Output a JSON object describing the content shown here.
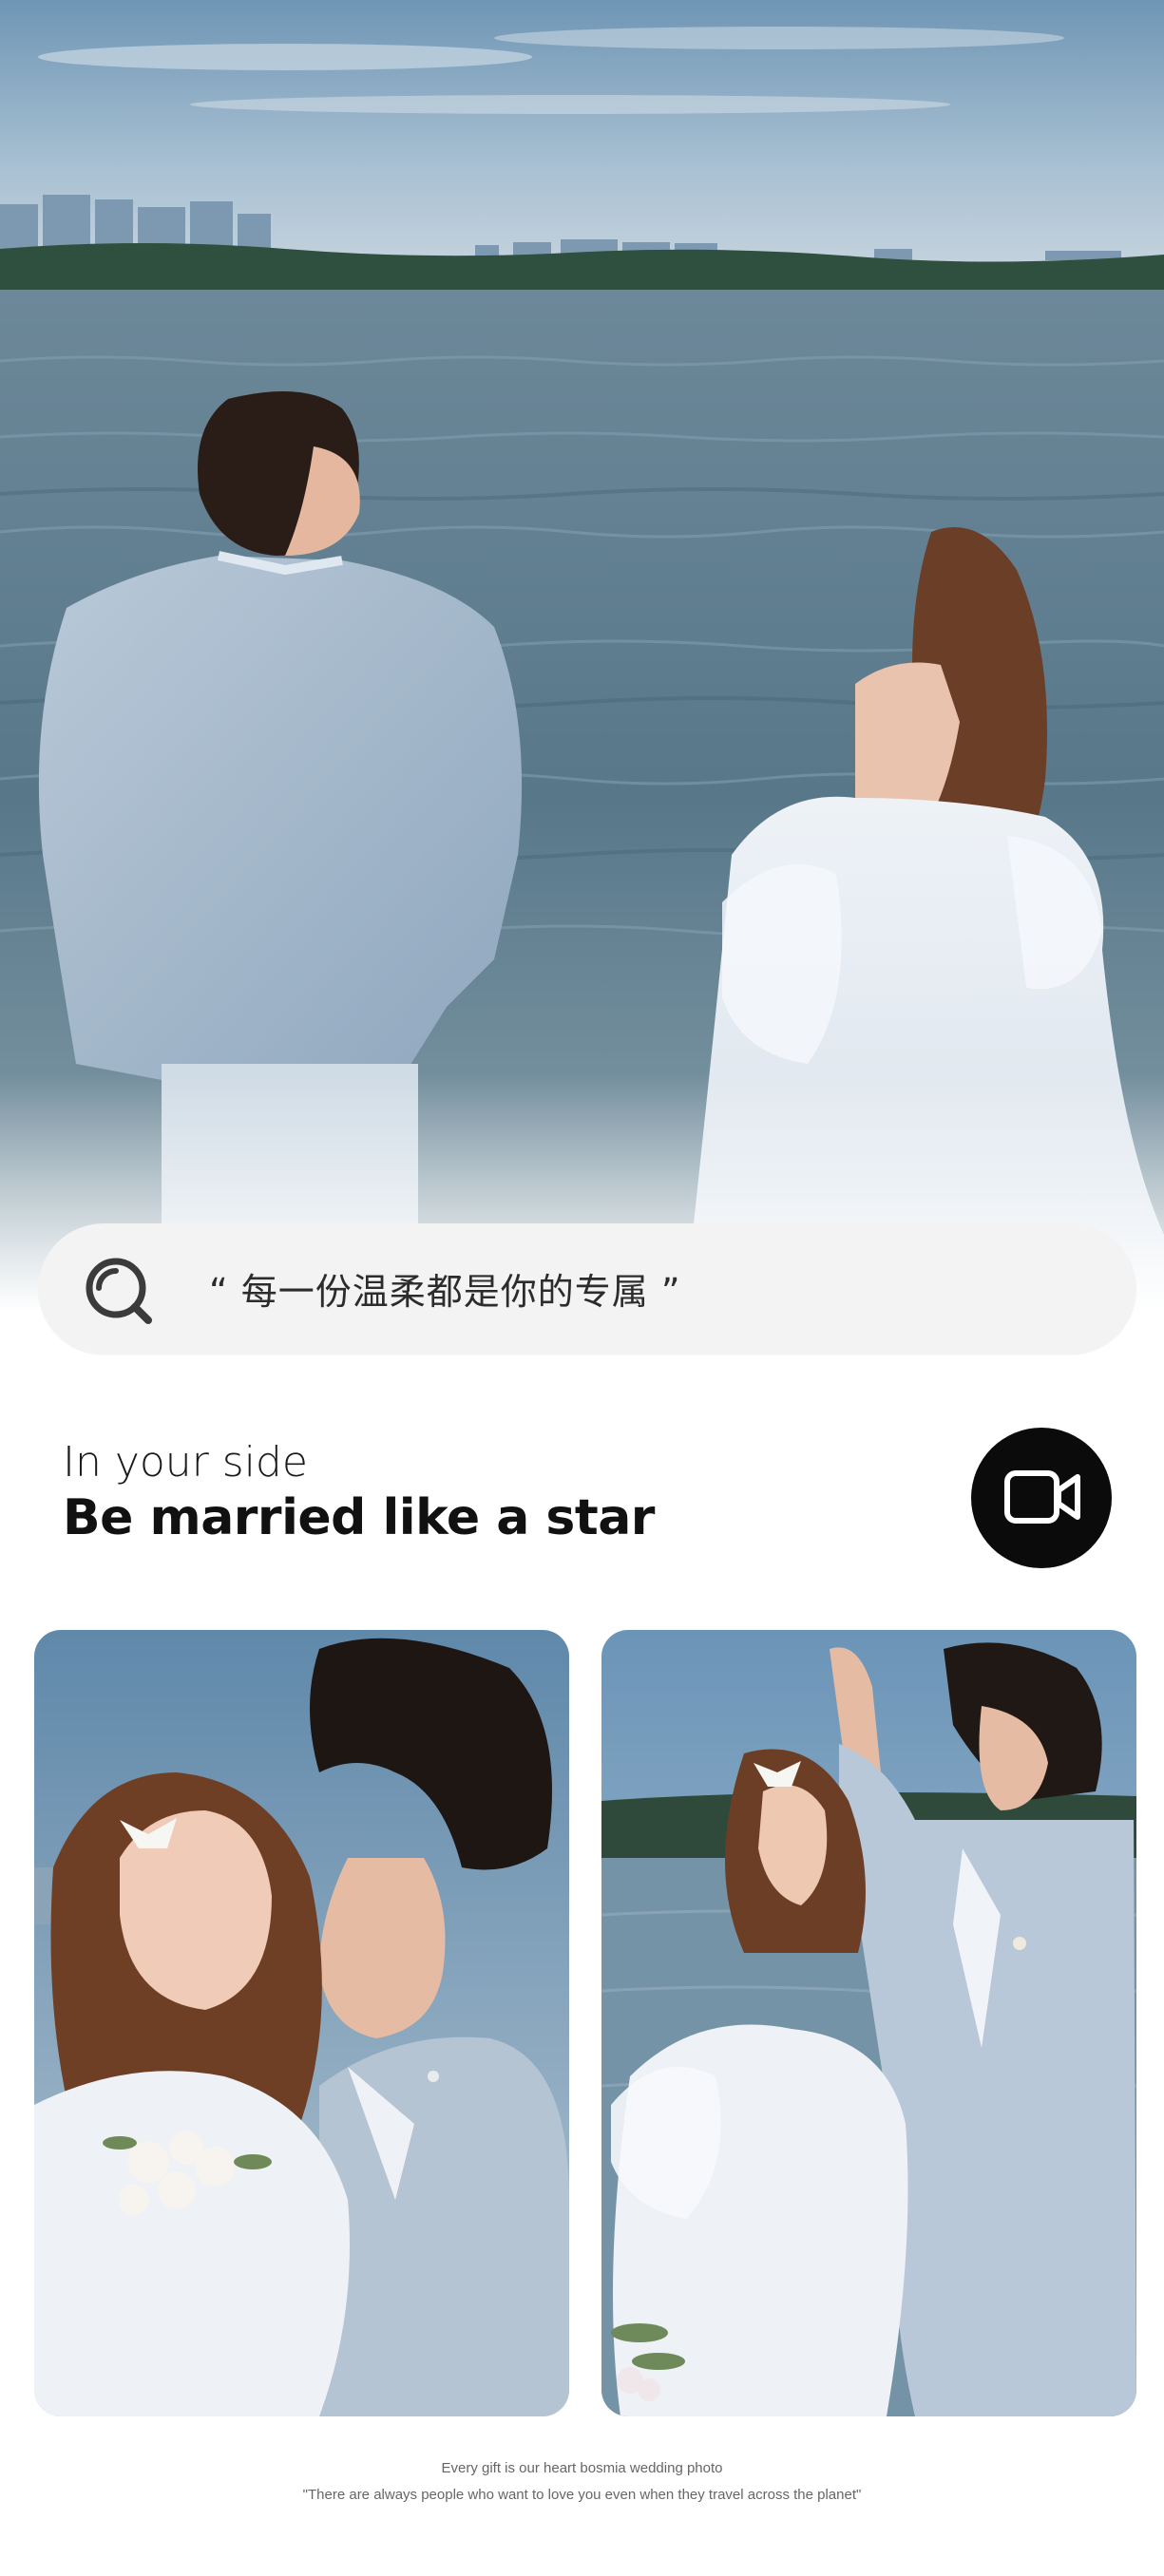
{
  "hero": {
    "image": "couple-by-the-sea-photo",
    "colors": {
      "sky": "#8fb1c8",
      "water": "#5f7f93",
      "fade": "#ffffff"
    }
  },
  "search": {
    "icon": "search-icon",
    "quote": "“ 每一份温柔都是你的专属 ”"
  },
  "heading": {
    "subtitle": "In your side",
    "title": "Be married like a star"
  },
  "video_button": {
    "icon": "video-camera-icon"
  },
  "gallery": [
    {
      "image": "bride-and-groom-portrait"
    },
    {
      "image": "couple-at-shore-portrait"
    }
  ],
  "footer": {
    "line1": "Every gift is our heart bosmia wedding photo",
    "line2": "\"There are always people who want to love you even when they travel across the planet\""
  },
  "colors": {
    "accent": "#0b0b0b",
    "pill": "#f3f3f3",
    "text": "#111111"
  }
}
